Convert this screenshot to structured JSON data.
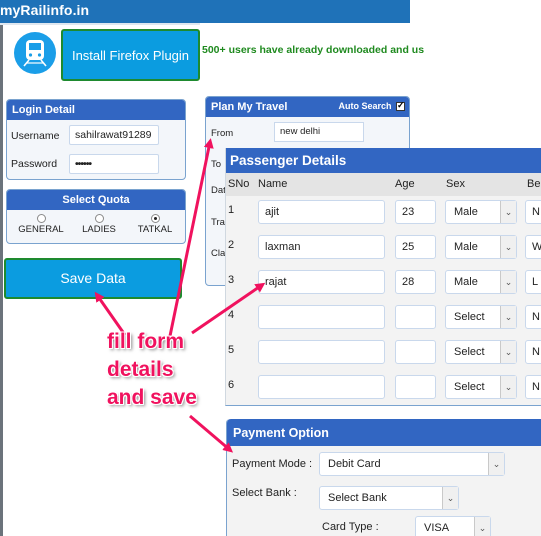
{
  "header": {
    "site_title": "myRailinfo.in"
  },
  "promo": {
    "logo_icon": "train-icon",
    "plugin_button": "Install Firefox Plugin",
    "download_note": "500+ users have already downloaded and us"
  },
  "login": {
    "title": "Login Detail",
    "username_label": "Username",
    "username_value": "sahilrawat91289",
    "password_label": "Password",
    "password_value": "••••••"
  },
  "quota": {
    "title": "Select Quota",
    "options": [
      {
        "label": "GENERAL",
        "selected": false
      },
      {
        "label": "LADIES",
        "selected": false
      },
      {
        "label": "TATKAL",
        "selected": true
      }
    ]
  },
  "save_button": "Save Data",
  "travel": {
    "title": "Plan My Travel",
    "auto_search_label": "Auto Search",
    "auto_search_checked": true,
    "from_label": "From",
    "from_value": "new delhi",
    "partial_labels": [
      "To",
      "Dat",
      "Trai",
      "Cla"
    ]
  },
  "passengers": {
    "title": "Passenger Details",
    "columns": [
      "SNo",
      "Name",
      "Age",
      "Sex",
      "Ber"
    ],
    "rows": [
      {
        "sno": "1",
        "name": "ajit",
        "age": "23",
        "sex": "Male",
        "berth": "N"
      },
      {
        "sno": "2",
        "name": "laxman",
        "age": "25",
        "sex": "Male",
        "berth": "W"
      },
      {
        "sno": "3",
        "name": "rajat",
        "age": "28",
        "sex": "Male",
        "berth": "L"
      },
      {
        "sno": "4",
        "name": "",
        "age": "",
        "sex": "Select",
        "berth": "N"
      },
      {
        "sno": "5",
        "name": "",
        "age": "",
        "sex": "Select",
        "berth": "N"
      },
      {
        "sno": "6",
        "name": "",
        "age": "",
        "sex": "Select",
        "berth": "N"
      }
    ]
  },
  "payment": {
    "title": "Payment Option",
    "mode_label": "Payment Mode :",
    "mode_value": "Debit Card",
    "bank_label": "Select Bank :",
    "bank_value": "Select Bank",
    "card_type_label": "Card Type :",
    "card_type_value": "VISA"
  },
  "annotation": {
    "lines": [
      "fill form",
      "details",
      "and save"
    ],
    "color": "#f0125e"
  }
}
